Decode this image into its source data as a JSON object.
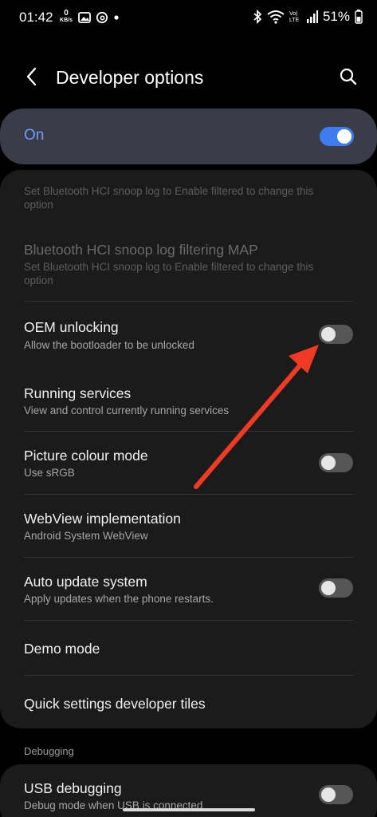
{
  "status_bar": {
    "time": "01:42",
    "kbs_top": "0",
    "kbs_bottom": "KB/s",
    "battery": "51%",
    "icons": [
      "gallery-icon",
      "threads-icon",
      "dot-icon",
      "bluetooth-icon",
      "wifi-icon",
      "volte-icon",
      "signal-icon",
      "battery-icon"
    ]
  },
  "header": {
    "title": "Developer options",
    "back_icon": "chevron-left-icon",
    "search_icon": "search-icon"
  },
  "master_switch": {
    "label": "On",
    "state": "on",
    "accent_color": "#3e7cf0",
    "label_color": "#6f9bff"
  },
  "items": [
    {
      "title": "",
      "subtitle": "Set Bluetooth HCI snoop log to Enable filtered to change this option",
      "disabled": true
    },
    {
      "title": "Bluetooth HCI snoop log filtering MAP",
      "subtitle": "Set Bluetooth HCI snoop log to Enable filtered to change this option",
      "disabled": true
    },
    {
      "title": "OEM unlocking",
      "subtitle": "Allow the bootloader to be unlocked",
      "toggle": "off"
    },
    {
      "title": "Running services",
      "subtitle": "View and control currently running services"
    },
    {
      "title": "Picture colour mode",
      "subtitle": "Use sRGB",
      "toggle": "off"
    },
    {
      "title": "WebView implementation",
      "subtitle": "Android System WebView"
    },
    {
      "title": "Auto update system",
      "subtitle": "Apply updates when the phone restarts.",
      "toggle": "off"
    },
    {
      "title": "Demo mode"
    },
    {
      "title": "Quick settings developer tiles"
    }
  ],
  "debugging": {
    "header": "Debugging",
    "items": [
      {
        "title": "USB debugging",
        "subtitle": "Debug mode when USB is connected",
        "toggle": "off"
      }
    ]
  },
  "annotation": {
    "type": "arrow",
    "color": "#f03a24",
    "points_to": "OEM unlocking toggle"
  }
}
